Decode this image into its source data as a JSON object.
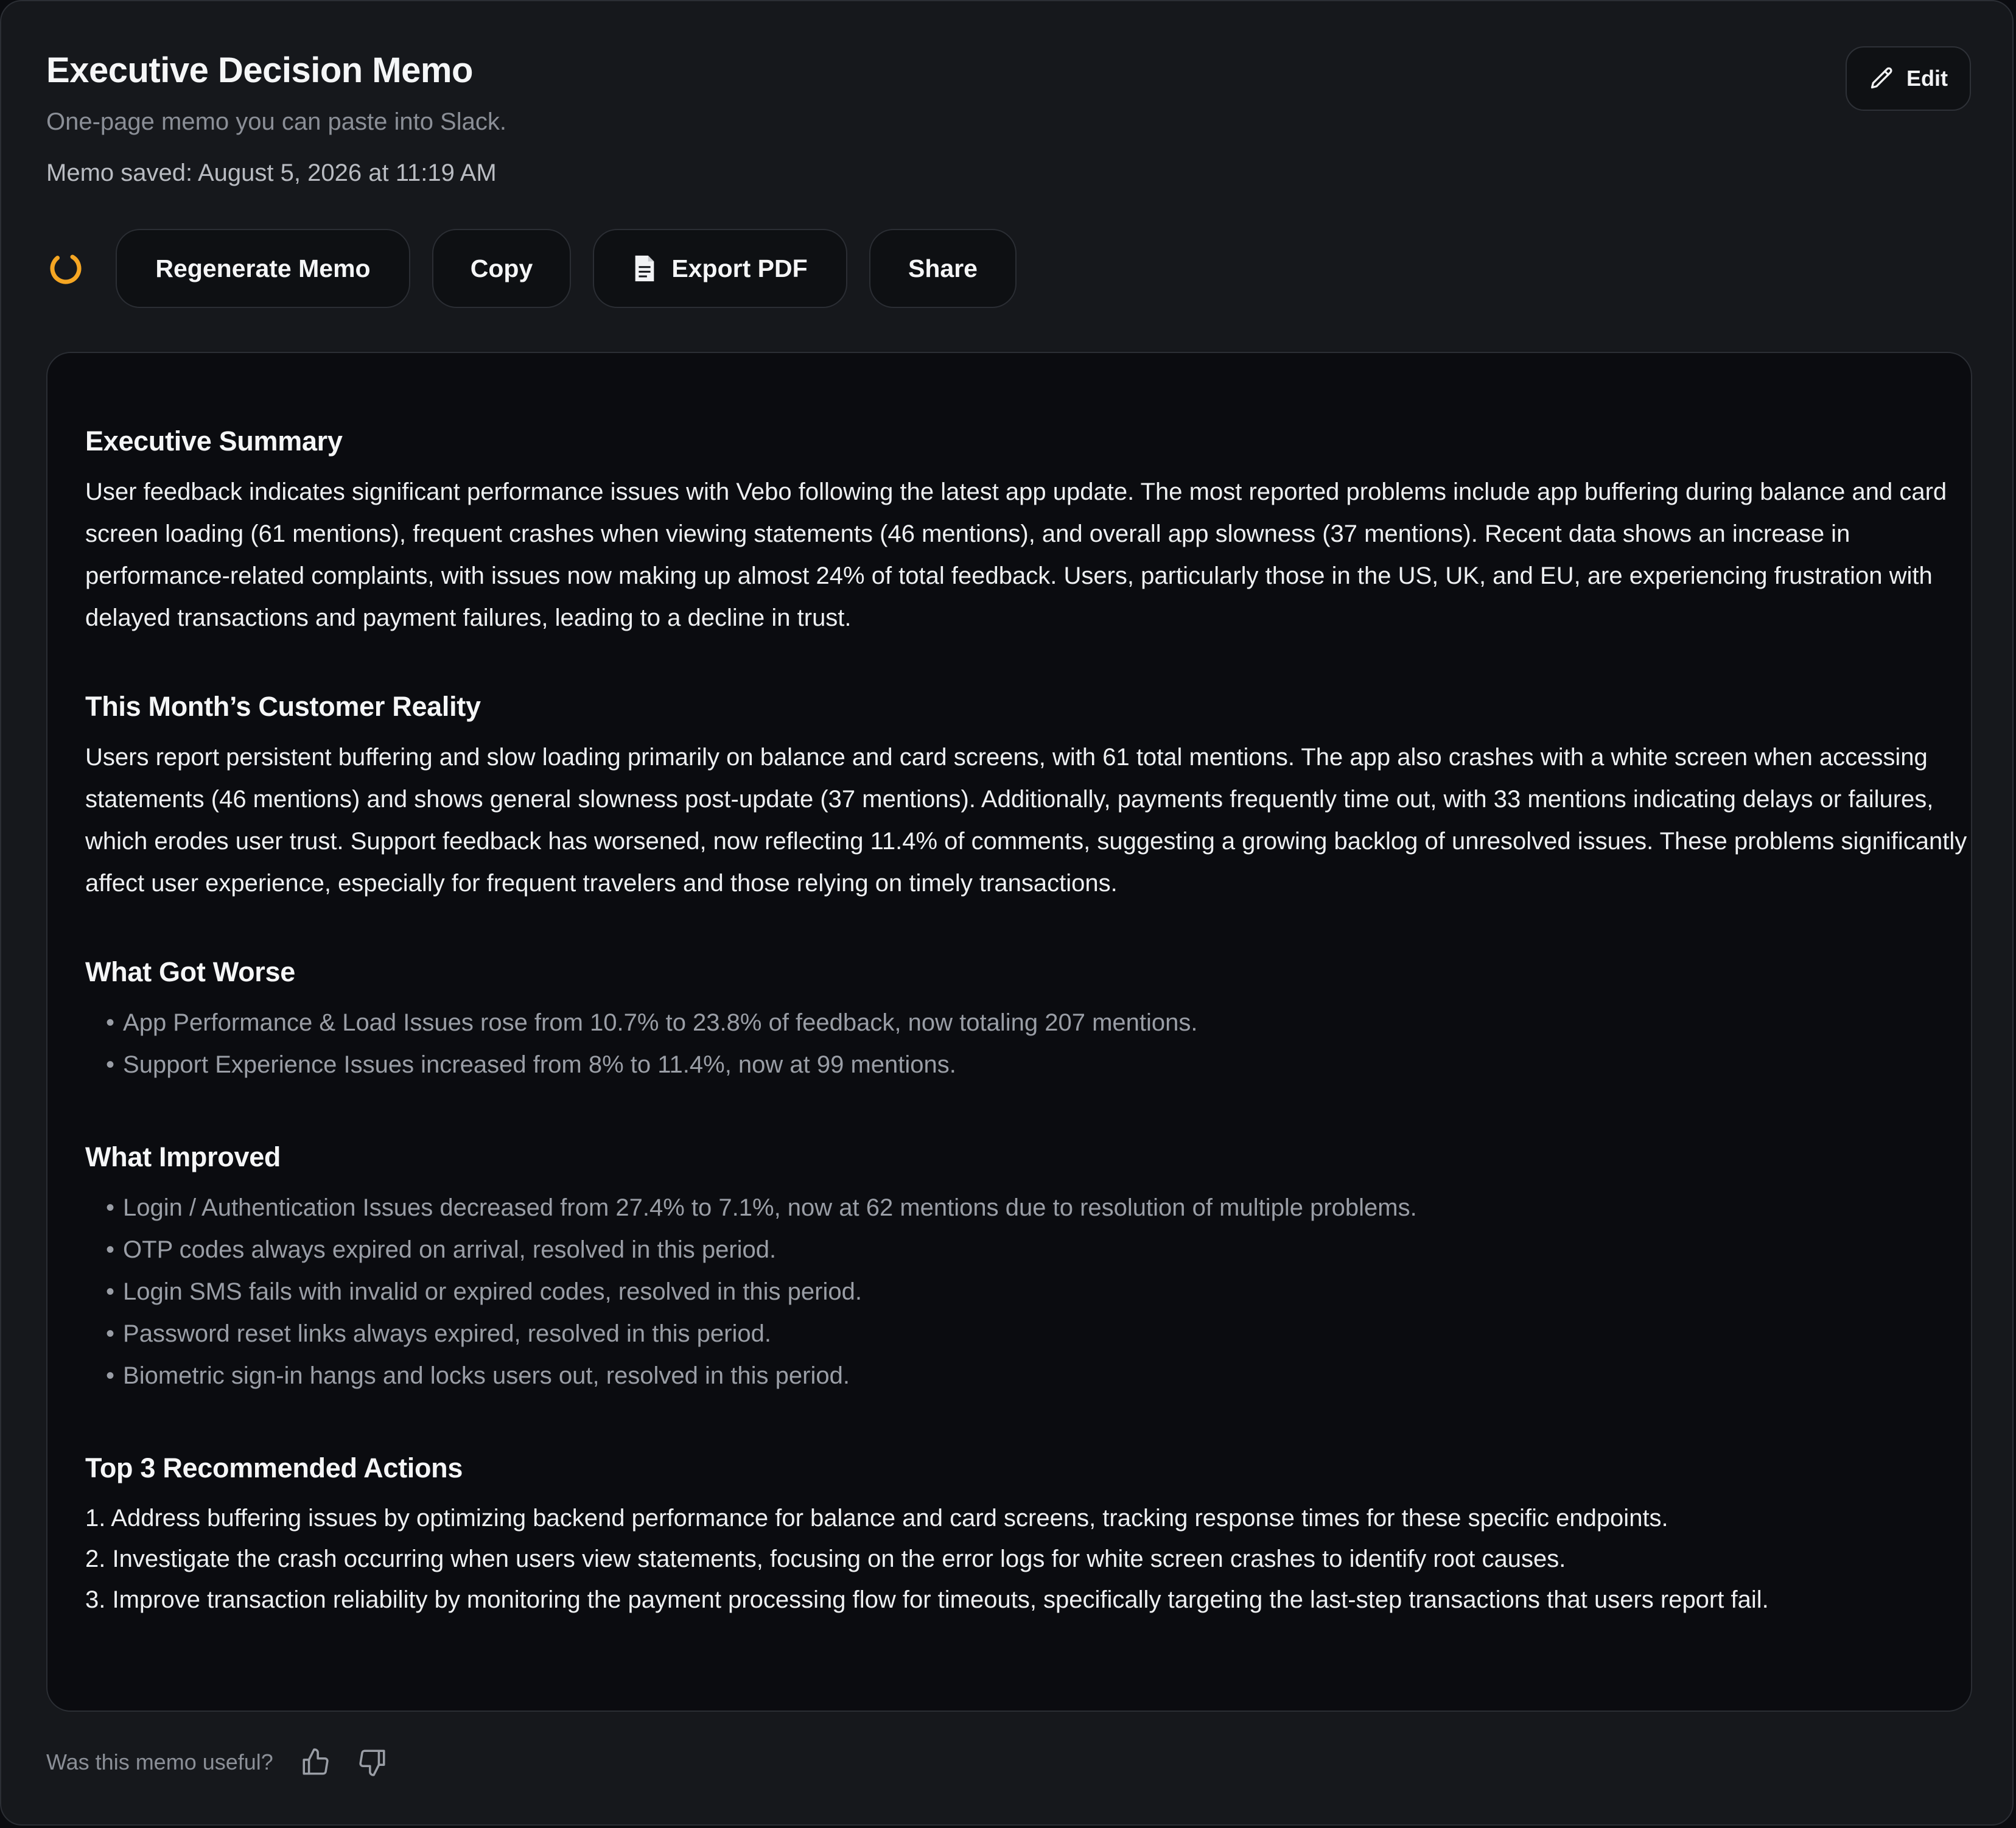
{
  "header": {
    "title": "Executive Decision Memo",
    "subtitle": "One-page memo you can paste into Slack.",
    "saved": "Memo saved: August 5, 2026 at 11:19 AM",
    "edit_label": "Edit"
  },
  "toolbar": {
    "regenerate_label": "Regenerate Memo",
    "copy_label": "Copy",
    "export_label": "Export PDF",
    "share_label": "Share"
  },
  "icons": {
    "spinner": "loading-spinner-icon",
    "edit": "pencil-icon",
    "export": "document-icon",
    "like": "thumbs-up-icon",
    "dislike": "thumbs-down-icon"
  },
  "colors": {
    "background": "#0b0c10",
    "card": "#16181c",
    "border": "#2b2e34",
    "accent_spinner": "#f5a623",
    "muted_text": "#9a9ea6"
  },
  "memo": {
    "summary": {
      "heading": "Executive Summary",
      "text": "User feedback indicates significant performance issues with Vebo following the latest app update. The most reported problems include app buffering during balance and card screen loading (61 mentions), frequent crashes when viewing statements (46 mentions), and overall app slowness (37 mentions). Recent data shows an increase in performance-related complaints, with issues now making up almost 24% of total feedback. Users, particularly those in the US, UK, and EU, are experiencing frustration with delayed transactions and payment failures, leading to a decline in trust."
    },
    "reality": {
      "heading": "This Month’s Customer Reality",
      "text": "Users report persistent buffering and slow loading primarily on balance and card screens, with 61 total mentions. The app also crashes with a white screen when accessing statements (46 mentions) and shows general slowness post-update (37 mentions). Additionally, payments frequently time out, with 33 mentions indicating delays or failures, which erodes user trust. Support feedback has worsened, now reflecting 11.4% of comments, suggesting a growing backlog of unresolved issues. These problems significantly affect user experience, especially for frequent travelers and those relying on timely transactions."
    },
    "worse": {
      "heading": "What Got Worse",
      "items": [
        "App Performance & Load Issues rose from 10.7% to 23.8% of feedback, now totaling 207 mentions.",
        "Support Experience Issues increased from 8% to 11.4%, now at 99 mentions."
      ]
    },
    "improved": {
      "heading": "What Improved",
      "items": [
        "Login / Authentication Issues decreased from 27.4% to 7.1%, now at 62 mentions due to resolution of multiple problems.",
        "OTP codes always expired on arrival, resolved in this period.",
        "Login SMS fails with invalid or expired codes, resolved in this period.",
        "Password reset links always expired, resolved in this period.",
        "Biometric sign-in hangs and locks users out, resolved in this period."
      ]
    },
    "actions": {
      "heading": "Top 3 Recommended Actions",
      "items": [
        "1. Address buffering issues by optimizing backend performance for balance and card screens, tracking response times for these specific endpoints.",
        "2. Investigate the crash occurring when users view statements, focusing on the error logs for white screen crashes to identify root causes.",
        "3. Improve transaction reliability by monitoring the payment processing flow for timeouts, specifically targeting the last-step transactions that users report fail."
      ]
    }
  },
  "feedback": {
    "question": "Was this memo useful?"
  }
}
